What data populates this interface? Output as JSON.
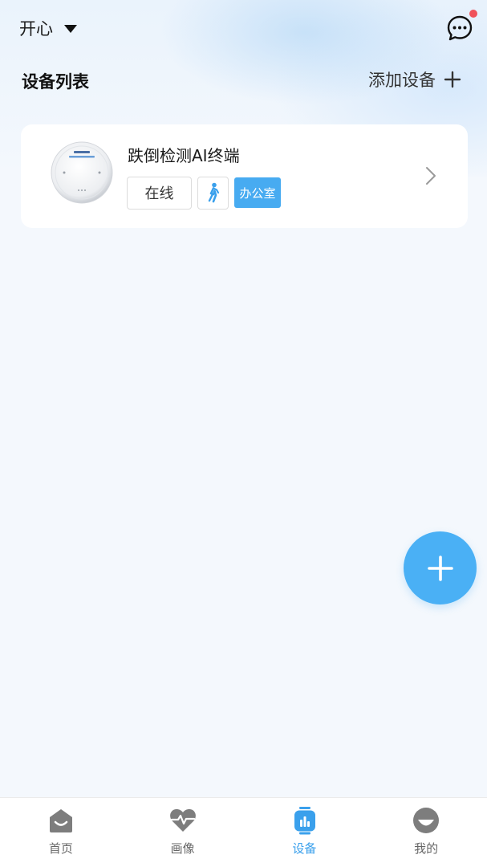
{
  "header": {
    "user_name": "开心",
    "message_icon": "chat-bubble-icon",
    "has_unread": true,
    "unread_color": "#f0515a"
  },
  "device_list": {
    "title": "设备列表",
    "add_label": "添加设备"
  },
  "devices": [
    {
      "name": "跌倒检测AI终端",
      "status": "在线",
      "mode_icon": "walking-person-icon",
      "room": "办公室"
    }
  ],
  "colors": {
    "accent": "#47abf1",
    "fab": "#4ab0f5",
    "active_tab": "#3aa0ec",
    "background": "#f4f8fd"
  },
  "tabs": [
    {
      "label": "首页",
      "icon": "home-icon",
      "active": false
    },
    {
      "label": "画像",
      "icon": "heart-pulse-icon",
      "active": false
    },
    {
      "label": "设备",
      "icon": "device-icon",
      "active": true
    },
    {
      "label": "我的",
      "icon": "profile-icon",
      "active": false
    }
  ]
}
